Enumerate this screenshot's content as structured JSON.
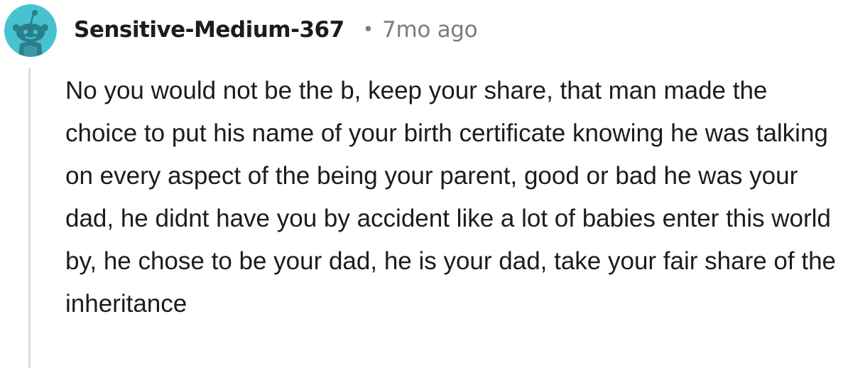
{
  "comment": {
    "author": "Sensitive-Medium-367",
    "separator": "•",
    "timestamp": "7mo ago",
    "avatar_icon": "reddit-snoo-avatar-icon",
    "avatar_color": "#47c3d0",
    "body": "No you would not be the b, keep your share, that man made the choice to put his name of your birth certificate knowing he was talking on every aspect of the being your parent, good or bad he was your dad, he didnt have you by accident like a lot of babies enter this world by, he chose to be your dad, he is your dad, take your fair share of the inheritance"
  }
}
